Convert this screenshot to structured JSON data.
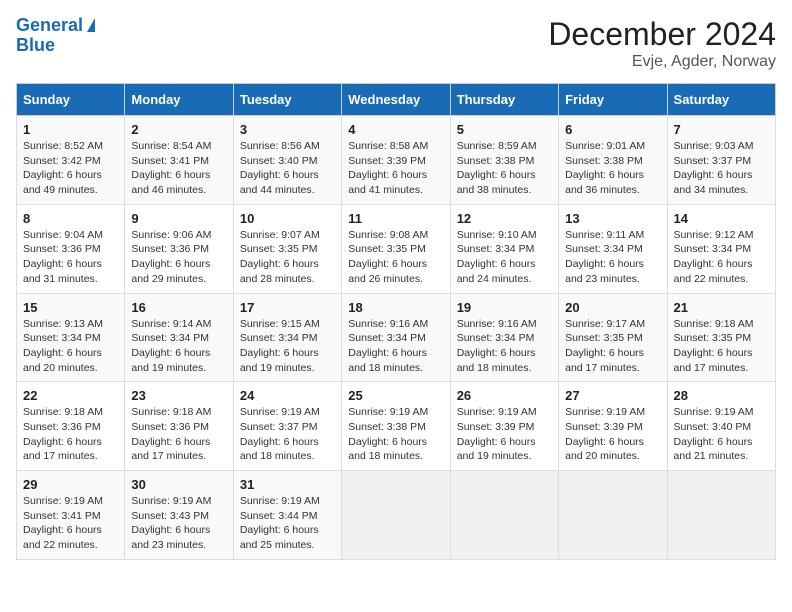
{
  "header": {
    "logo_line1": "General",
    "logo_line2": "Blue",
    "title": "December 2024",
    "subtitle": "Evje, Agder, Norway"
  },
  "calendar": {
    "days_of_week": [
      "Sunday",
      "Monday",
      "Tuesday",
      "Wednesday",
      "Thursday",
      "Friday",
      "Saturday"
    ],
    "weeks": [
      [
        null,
        null,
        {
          "day": "1",
          "sunrise": "8:52 AM",
          "sunset": "3:42 PM",
          "daylight": "6 hours and 49 minutes."
        },
        {
          "day": "2",
          "sunrise": "8:54 AM",
          "sunset": "3:41 PM",
          "daylight": "6 hours and 46 minutes."
        },
        {
          "day": "3",
          "sunrise": "8:56 AM",
          "sunset": "3:40 PM",
          "daylight": "6 hours and 44 minutes."
        },
        {
          "day": "4",
          "sunrise": "8:58 AM",
          "sunset": "3:39 PM",
          "daylight": "6 hours and 41 minutes."
        },
        {
          "day": "5",
          "sunrise": "8:59 AM",
          "sunset": "3:38 PM",
          "daylight": "6 hours and 38 minutes."
        },
        {
          "day": "6",
          "sunrise": "9:01 AM",
          "sunset": "3:38 PM",
          "daylight": "6 hours and 36 minutes."
        },
        {
          "day": "7",
          "sunrise": "9:03 AM",
          "sunset": "3:37 PM",
          "daylight": "6 hours and 34 minutes."
        }
      ],
      [
        {
          "day": "8",
          "sunrise": "9:04 AM",
          "sunset": "3:36 PM",
          "daylight": "6 hours and 31 minutes."
        },
        {
          "day": "9",
          "sunrise": "9:06 AM",
          "sunset": "3:36 PM",
          "daylight": "6 hours and 29 minutes."
        },
        {
          "day": "10",
          "sunrise": "9:07 AM",
          "sunset": "3:35 PM",
          "daylight": "6 hours and 28 minutes."
        },
        {
          "day": "11",
          "sunrise": "9:08 AM",
          "sunset": "3:35 PM",
          "daylight": "6 hours and 26 minutes."
        },
        {
          "day": "12",
          "sunrise": "9:10 AM",
          "sunset": "3:34 PM",
          "daylight": "6 hours and 24 minutes."
        },
        {
          "day": "13",
          "sunrise": "9:11 AM",
          "sunset": "3:34 PM",
          "daylight": "6 hours and 23 minutes."
        },
        {
          "day": "14",
          "sunrise": "9:12 AM",
          "sunset": "3:34 PM",
          "daylight": "6 hours and 22 minutes."
        }
      ],
      [
        {
          "day": "15",
          "sunrise": "9:13 AM",
          "sunset": "3:34 PM",
          "daylight": "6 hours and 20 minutes."
        },
        {
          "day": "16",
          "sunrise": "9:14 AM",
          "sunset": "3:34 PM",
          "daylight": "6 hours and 19 minutes."
        },
        {
          "day": "17",
          "sunrise": "9:15 AM",
          "sunset": "3:34 PM",
          "daylight": "6 hours and 19 minutes."
        },
        {
          "day": "18",
          "sunrise": "9:16 AM",
          "sunset": "3:34 PM",
          "daylight": "6 hours and 18 minutes."
        },
        {
          "day": "19",
          "sunrise": "9:16 AM",
          "sunset": "3:34 PM",
          "daylight": "6 hours and 18 minutes."
        },
        {
          "day": "20",
          "sunrise": "9:17 AM",
          "sunset": "3:35 PM",
          "daylight": "6 hours and 17 minutes."
        },
        {
          "day": "21",
          "sunrise": "9:18 AM",
          "sunset": "3:35 PM",
          "daylight": "6 hours and 17 minutes."
        }
      ],
      [
        {
          "day": "22",
          "sunrise": "9:18 AM",
          "sunset": "3:36 PM",
          "daylight": "6 hours and 17 minutes."
        },
        {
          "day": "23",
          "sunrise": "9:18 AM",
          "sunset": "3:36 PM",
          "daylight": "6 hours and 17 minutes."
        },
        {
          "day": "24",
          "sunrise": "9:19 AM",
          "sunset": "3:37 PM",
          "daylight": "6 hours and 18 minutes."
        },
        {
          "day": "25",
          "sunrise": "9:19 AM",
          "sunset": "3:38 PM",
          "daylight": "6 hours and 18 minutes."
        },
        {
          "day": "26",
          "sunrise": "9:19 AM",
          "sunset": "3:39 PM",
          "daylight": "6 hours and 19 minutes."
        },
        {
          "day": "27",
          "sunrise": "9:19 AM",
          "sunset": "3:39 PM",
          "daylight": "6 hours and 20 minutes."
        },
        {
          "day": "28",
          "sunrise": "9:19 AM",
          "sunset": "3:40 PM",
          "daylight": "6 hours and 21 minutes."
        }
      ],
      [
        {
          "day": "29",
          "sunrise": "9:19 AM",
          "sunset": "3:41 PM",
          "daylight": "6 hours and 22 minutes."
        },
        {
          "day": "30",
          "sunrise": "9:19 AM",
          "sunset": "3:43 PM",
          "daylight": "6 hours and 23 minutes."
        },
        {
          "day": "31",
          "sunrise": "9:19 AM",
          "sunset": "3:44 PM",
          "daylight": "6 hours and 25 minutes."
        },
        null,
        null,
        null,
        null
      ]
    ]
  }
}
